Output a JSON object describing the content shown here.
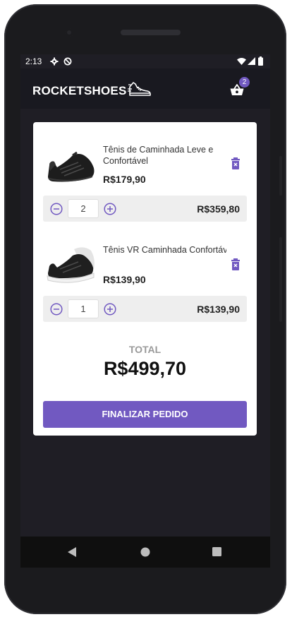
{
  "status_bar": {
    "time": "2:13"
  },
  "header": {
    "logo": "ROCKETSHOES",
    "cart_count": "2"
  },
  "cart": {
    "items": [
      {
        "name": "Tênis de Caminhada Leve e Confortável",
        "price": "R$179,90",
        "quantity": "2",
        "subtotal": "R$359,80"
      },
      {
        "name": "Tênis VR Caminhada Confortável Detalhes Couro ...",
        "price": "R$139,90",
        "quantity": "1",
        "subtotal": "R$139,90"
      }
    ],
    "total_label": "TOTAL",
    "total_value": "R$499,70",
    "checkout_label": "FINALIZAR PEDIDO"
  },
  "colors": {
    "accent": "#7159c1",
    "background": "#1f1e25",
    "header": "#191920"
  }
}
